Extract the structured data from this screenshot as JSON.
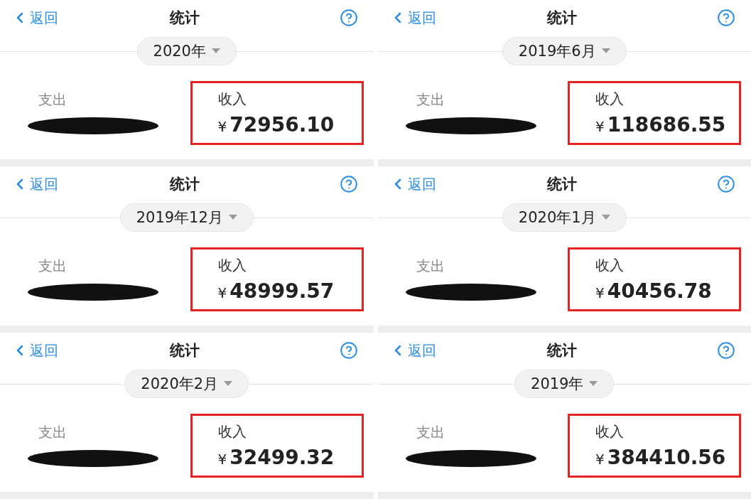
{
  "panels": [
    {
      "back": "返回",
      "title": "统计",
      "period": "2020年",
      "expense_label": "支出",
      "income_label": "收入",
      "currency": "¥",
      "income": "72956.10"
    },
    {
      "back": "返回",
      "title": "统计",
      "period": "2019年6月",
      "expense_label": "支出",
      "income_label": "收入",
      "currency": "¥",
      "income": "118686.55"
    },
    {
      "back": "返回",
      "title": "统计",
      "period": "2019年12月",
      "expense_label": "支出",
      "income_label": "收入",
      "currency": "¥",
      "income": "48999.57"
    },
    {
      "back": "返回",
      "title": "统计",
      "period": "2020年1月",
      "expense_label": "支出",
      "income_label": "收入",
      "currency": "¥",
      "income": "40456.78"
    },
    {
      "back": "返回",
      "title": "统计",
      "period": "2020年2月",
      "expense_label": "支出",
      "income_label": "收入",
      "currency": "¥",
      "income": "32499.32"
    },
    {
      "back": "返回",
      "title": "统计",
      "period": "2019年",
      "expense_label": "支出",
      "income_label": "收入",
      "currency": "¥",
      "income": "384410.56"
    }
  ]
}
